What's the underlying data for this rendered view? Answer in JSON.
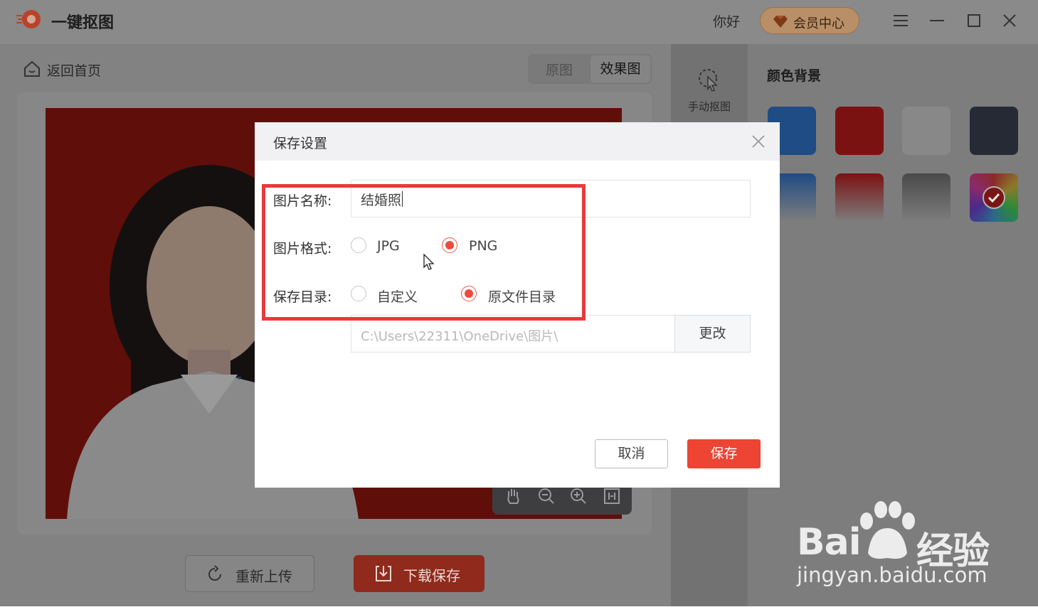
{
  "app": {
    "name": "一键抠图",
    "greeting": "你好",
    "member_center": "会员中心"
  },
  "toolbar": {
    "back_home": "返回首页",
    "view_original": "原图",
    "view_effect": "效果图"
  },
  "tools": {
    "manual_cutout": "手动抠图"
  },
  "actions": {
    "reupload": "重新上传",
    "download_save": "下载保存"
  },
  "color_panel": {
    "title": "颜色背景",
    "swatches": [
      {
        "name": "solid-blue",
        "color": "#1e4a82"
      },
      {
        "name": "solid-red",
        "color": "#7a1212"
      },
      {
        "name": "solid-white",
        "color": "#888888"
      },
      {
        "name": "solid-dark-gray",
        "color": "#262a34"
      },
      {
        "name": "gradient-blue",
        "color": "#1e4a82"
      },
      {
        "name": "gradient-red",
        "color": "#7a1212"
      },
      {
        "name": "gradient-gray",
        "color": "#555555"
      },
      {
        "name": "rainbow-custom",
        "color": "#888888",
        "selected": true
      }
    ]
  },
  "dialog": {
    "title": "保存设置",
    "name_label": "图片名称:",
    "name_value": "结婚照",
    "format_label": "图片格式:",
    "format_options": [
      "JPG",
      "PNG"
    ],
    "format_selected": "PNG",
    "dir_label": "保存目录:",
    "dir_options": [
      "自定义",
      "原文件目录"
    ],
    "dir_selected": "原文件目录",
    "path_placeholder": "C:\\Users\\22311\\OneDrive\\图片\\",
    "change_button": "更改",
    "cancel_button": "取消",
    "save_button": "保存"
  },
  "watermark": {
    "brand_left": "Bai",
    "brand_right": "经验",
    "url": "jingyan.baidu.com"
  }
}
